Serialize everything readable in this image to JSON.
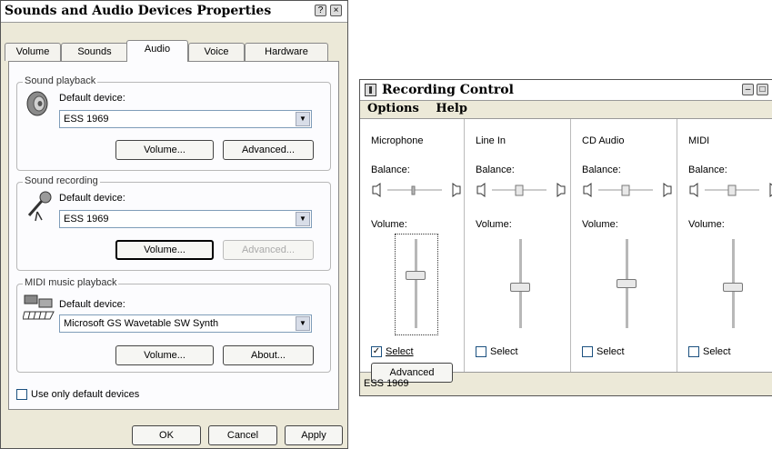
{
  "props": {
    "title": "Sounds and Audio Devices Properties",
    "help_btn": "?",
    "close_btn": "×",
    "tabs": [
      "Volume",
      "Sounds",
      "Audio",
      "Voice",
      "Hardware"
    ],
    "active_tab": "Audio",
    "playback": {
      "group_label": "Sound playback",
      "device_label": "Default device:",
      "device_value": "ESS 1969",
      "volume_btn": "Volume...",
      "advanced_btn": "Advanced..."
    },
    "recording": {
      "group_label": "Sound recording",
      "device_label": "Default device:",
      "device_value": "ESS 1969",
      "volume_btn": "Volume...",
      "advanced_btn": "Advanced..."
    },
    "midi": {
      "group_label": "MIDI music playback",
      "device_label": "Default device:",
      "device_value": "Microsoft GS Wavetable SW Synth",
      "volume_btn": "Volume...",
      "about_btn": "About..."
    },
    "use_default_label": "Use only default devices",
    "ok_btn": "OK",
    "cancel_btn": "Cancel",
    "apply_btn": "Apply"
  },
  "recording_control": {
    "title": "Recording Control",
    "menu": [
      "Options",
      "Help"
    ],
    "balance_label": "Balance:",
    "volume_label": "Volume:",
    "select_label": "Select",
    "advanced_btn": "Advanced",
    "status": "ESS 1969",
    "channels": [
      {
        "name": "Microphone",
        "selected": true,
        "volume_fraction": 0.6
      },
      {
        "name": "Line In",
        "selected": false,
        "volume_fraction": 0.45
      },
      {
        "name": "CD Audio",
        "selected": false,
        "volume_fraction": 0.5
      },
      {
        "name": "MIDI",
        "selected": false,
        "volume_fraction": 0.45
      }
    ],
    "channel_selected_marks": [
      "✓",
      "",
      "",
      ""
    ]
  }
}
